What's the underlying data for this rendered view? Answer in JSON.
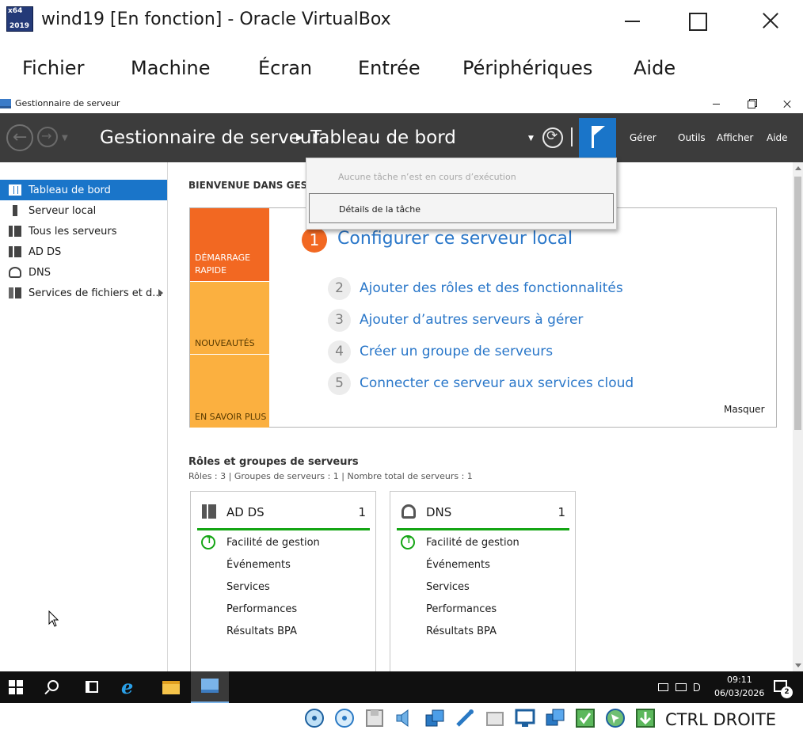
{
  "vbox": {
    "title": "wind19 [En fonction] - Oracle VirtualBox",
    "icon_text_top": "x64",
    "icon_text_bottom": "2019",
    "menu": [
      "Fichier",
      "Machine",
      "Écran",
      "Entrée",
      "Périphériques",
      "Aide"
    ],
    "host_key": "CTRL DROITE",
    "status_icons": [
      "hard-disk-icon",
      "optical-drive-icon",
      "floppy-icon",
      "audio-icon",
      "network-icon",
      "usb-icon",
      "shared-folders-icon",
      "display-icon",
      "video-capture-icon",
      "virtualization-icon",
      "mouse-integration-icon",
      "download-icon"
    ]
  },
  "server_manager": {
    "window_title": "Gestionnaire de serveur",
    "breadcrumb": {
      "root": "Gestionnaire de serveur",
      "current": "Tableau de bord"
    },
    "header_menu": [
      "Gérer",
      "Outils",
      "Afficher",
      "Aide"
    ],
    "sidebar": [
      {
        "label": "Tableau de bord",
        "icon": "dashboard-grid-icon",
        "active": true
      },
      {
        "label": "Serveur local",
        "icon": "server-icon"
      },
      {
        "label": "Tous les serveurs",
        "icon": "servers-icon"
      },
      {
        "label": "AD DS",
        "icon": "ad-ds-icon"
      },
      {
        "label": "DNS",
        "icon": "dns-icon"
      },
      {
        "label": "Services de fichiers et d...",
        "icon": "file-services-icon"
      }
    ],
    "welcome": {
      "heading": "BIENVENUE DANS GES",
      "tiles": [
        "DÉMARRAGE RAPIDE",
        "NOUVEAUTÉS",
        "EN SAVOIR PLUS"
      ],
      "steps": [
        {
          "num": "1",
          "label": "Configurer ce serveur local"
        },
        {
          "num": "2",
          "label": "Ajouter des rôles et des fonctionnalités"
        },
        {
          "num": "3",
          "label": "Ajouter d’autres serveurs à gérer"
        },
        {
          "num": "4",
          "label": "Créer un groupe de serveurs"
        },
        {
          "num": "5",
          "label": "Connecter ce serveur aux services cloud"
        }
      ],
      "hide": "Masquer"
    },
    "roles": {
      "title": "Rôles et groupes de serveurs",
      "summary": "Rôles : 3   |   Groupes de serveurs : 1   |   Nombre total de serveurs : 1",
      "cards": [
        {
          "name": "AD DS",
          "count": "1",
          "rows": [
            "Facilité de gestion",
            "Événements",
            "Services",
            "Performances",
            "Résultats BPA"
          ]
        },
        {
          "name": "DNS",
          "count": "1",
          "rows": [
            "Facilité de gestion",
            "Événements",
            "Services",
            "Performances",
            "Résultats BPA"
          ]
        }
      ]
    },
    "notifications": {
      "message": "Aucune tâche n’est en cours d’exécution",
      "details": "Détails de la tâche"
    }
  },
  "taskbar": {
    "time": "09:11",
    "date": "06/03/2026",
    "notification_count": "2"
  }
}
